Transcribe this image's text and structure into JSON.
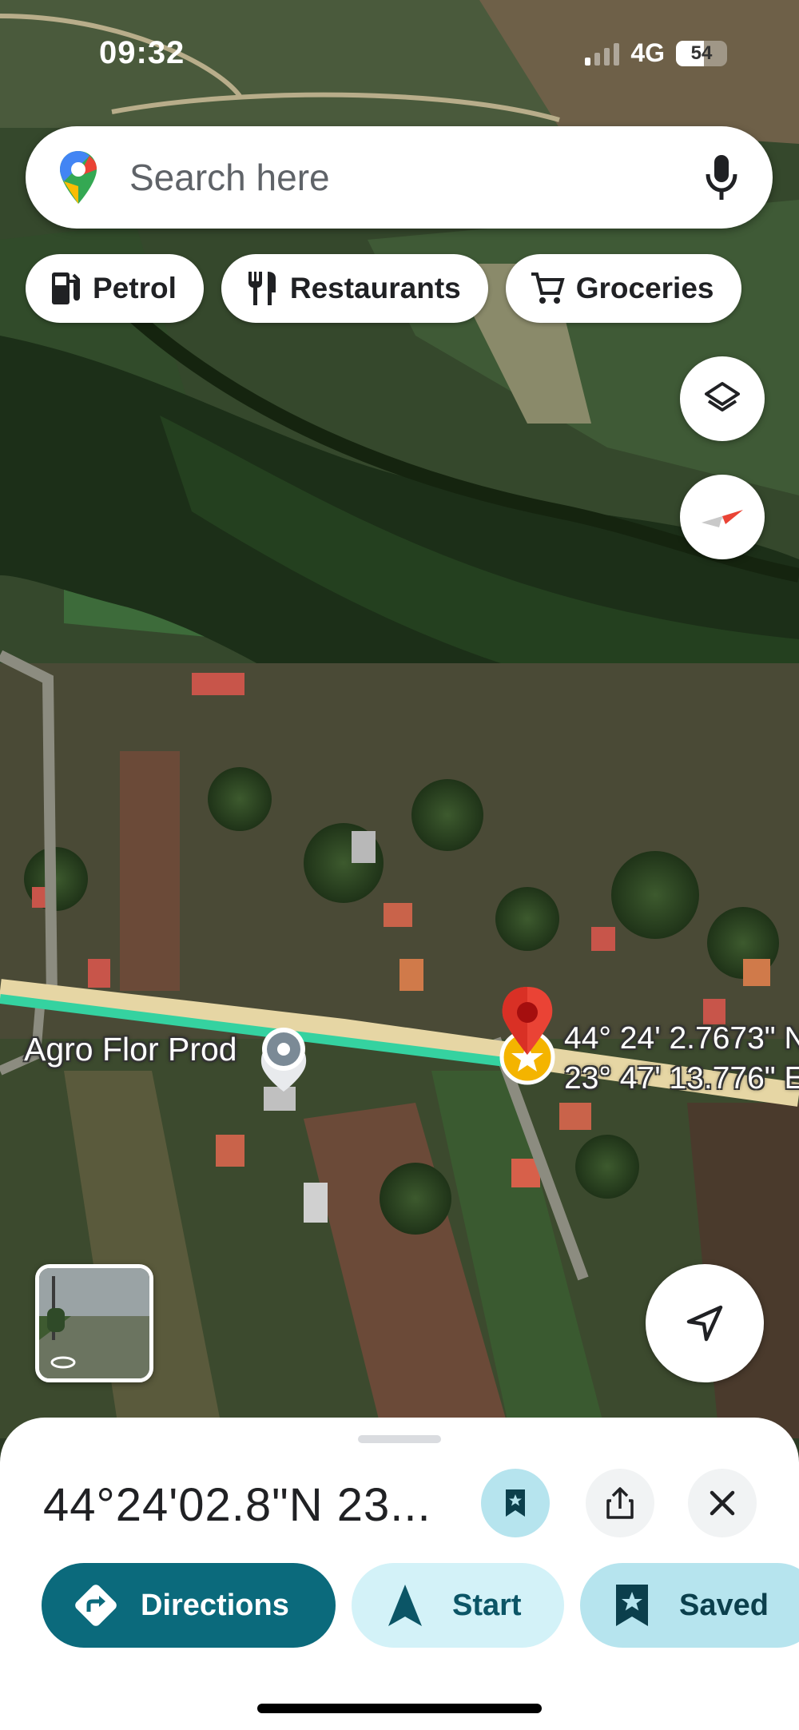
{
  "status_bar": {
    "time": "09:32",
    "network": "4G",
    "battery": "54",
    "battery_level": 0.54
  },
  "search": {
    "placeholder": "Search here"
  },
  "chips": [
    {
      "label": "Petrol",
      "icon": "fuel-icon"
    },
    {
      "label": "Restaurants",
      "icon": "fork-knife-icon"
    },
    {
      "label": "Groceries",
      "icon": "cart-icon"
    }
  ],
  "map": {
    "place_label": "Agro Flor Prod",
    "coord_line1": "44° 24' 2.7673\" N",
    "coord_line2": "23° 47' 13.776\" E",
    "layers_icon": "layers-icon",
    "compass_icon": "compass-icon",
    "locate_icon": "navigation-arrow-icon"
  },
  "sheet": {
    "title": "44°24'02.8\"N 23...",
    "actions": {
      "directions": "Directions",
      "start": "Start",
      "saved": "Saved"
    }
  },
  "colors": {
    "accent_dark": "#0b6a7c",
    "accent_light": "#d3f2f8",
    "saved_bg": "#b6e4ee",
    "route": "#35d2a0",
    "pin": "#ea4335"
  }
}
